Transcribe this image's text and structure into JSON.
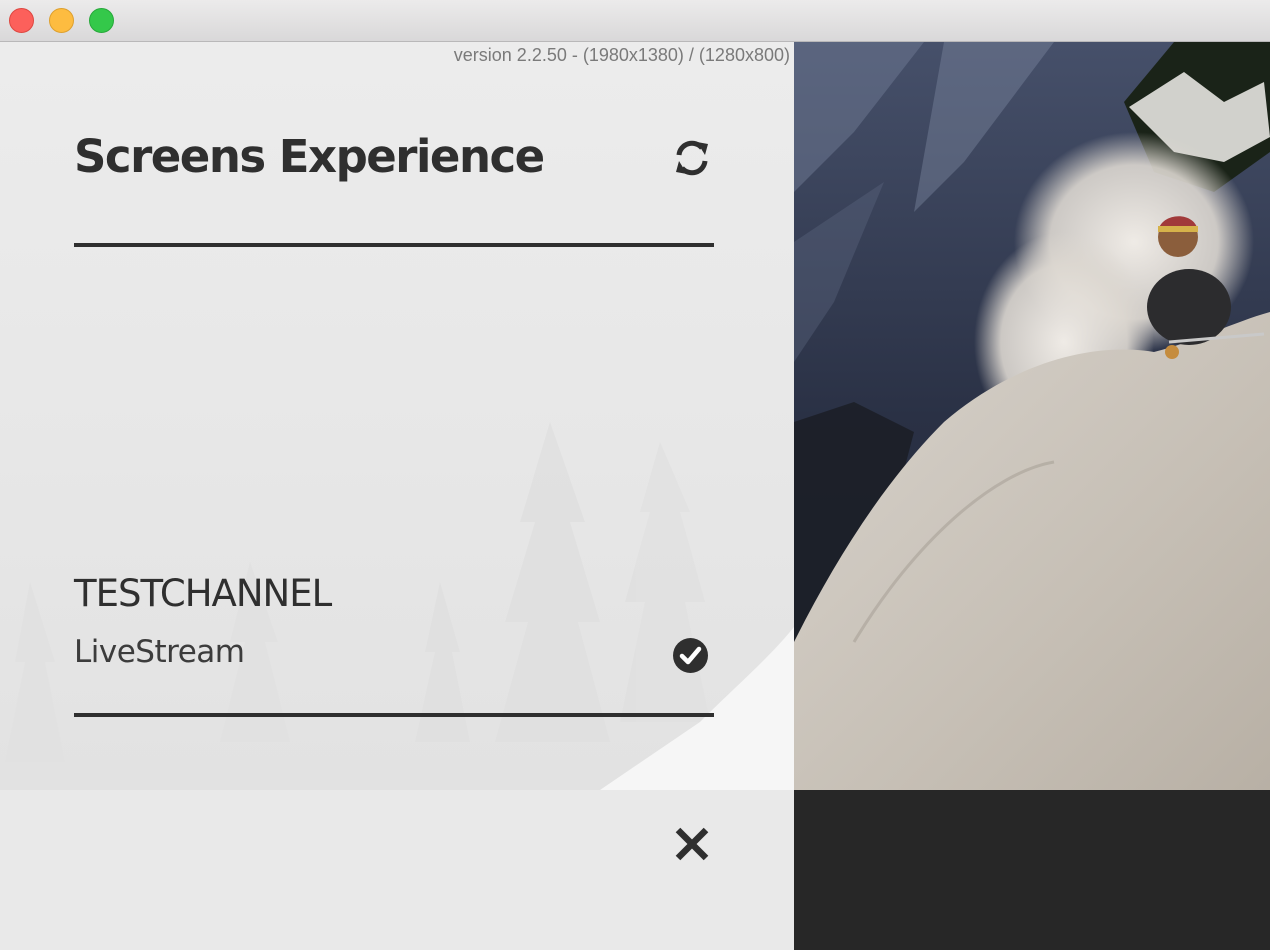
{
  "window": {
    "controls": [
      "close",
      "minimize",
      "maximize"
    ]
  },
  "panel": {
    "version": "version 2.2.50 - (1980x1380) / (1280x800)",
    "title": "Screens Experience",
    "refresh_icon": "refresh-icon",
    "channel": {
      "name": "TESTCHANNEL",
      "subtitle": "LiveStream",
      "status_icon": "check-circle-icon"
    }
  },
  "footer": {
    "close_icon": "close-icon"
  },
  "colors": {
    "text_dark": "#2f2f2f",
    "panel_bg": "#e9e9e9",
    "footer_dark": "#272727"
  }
}
